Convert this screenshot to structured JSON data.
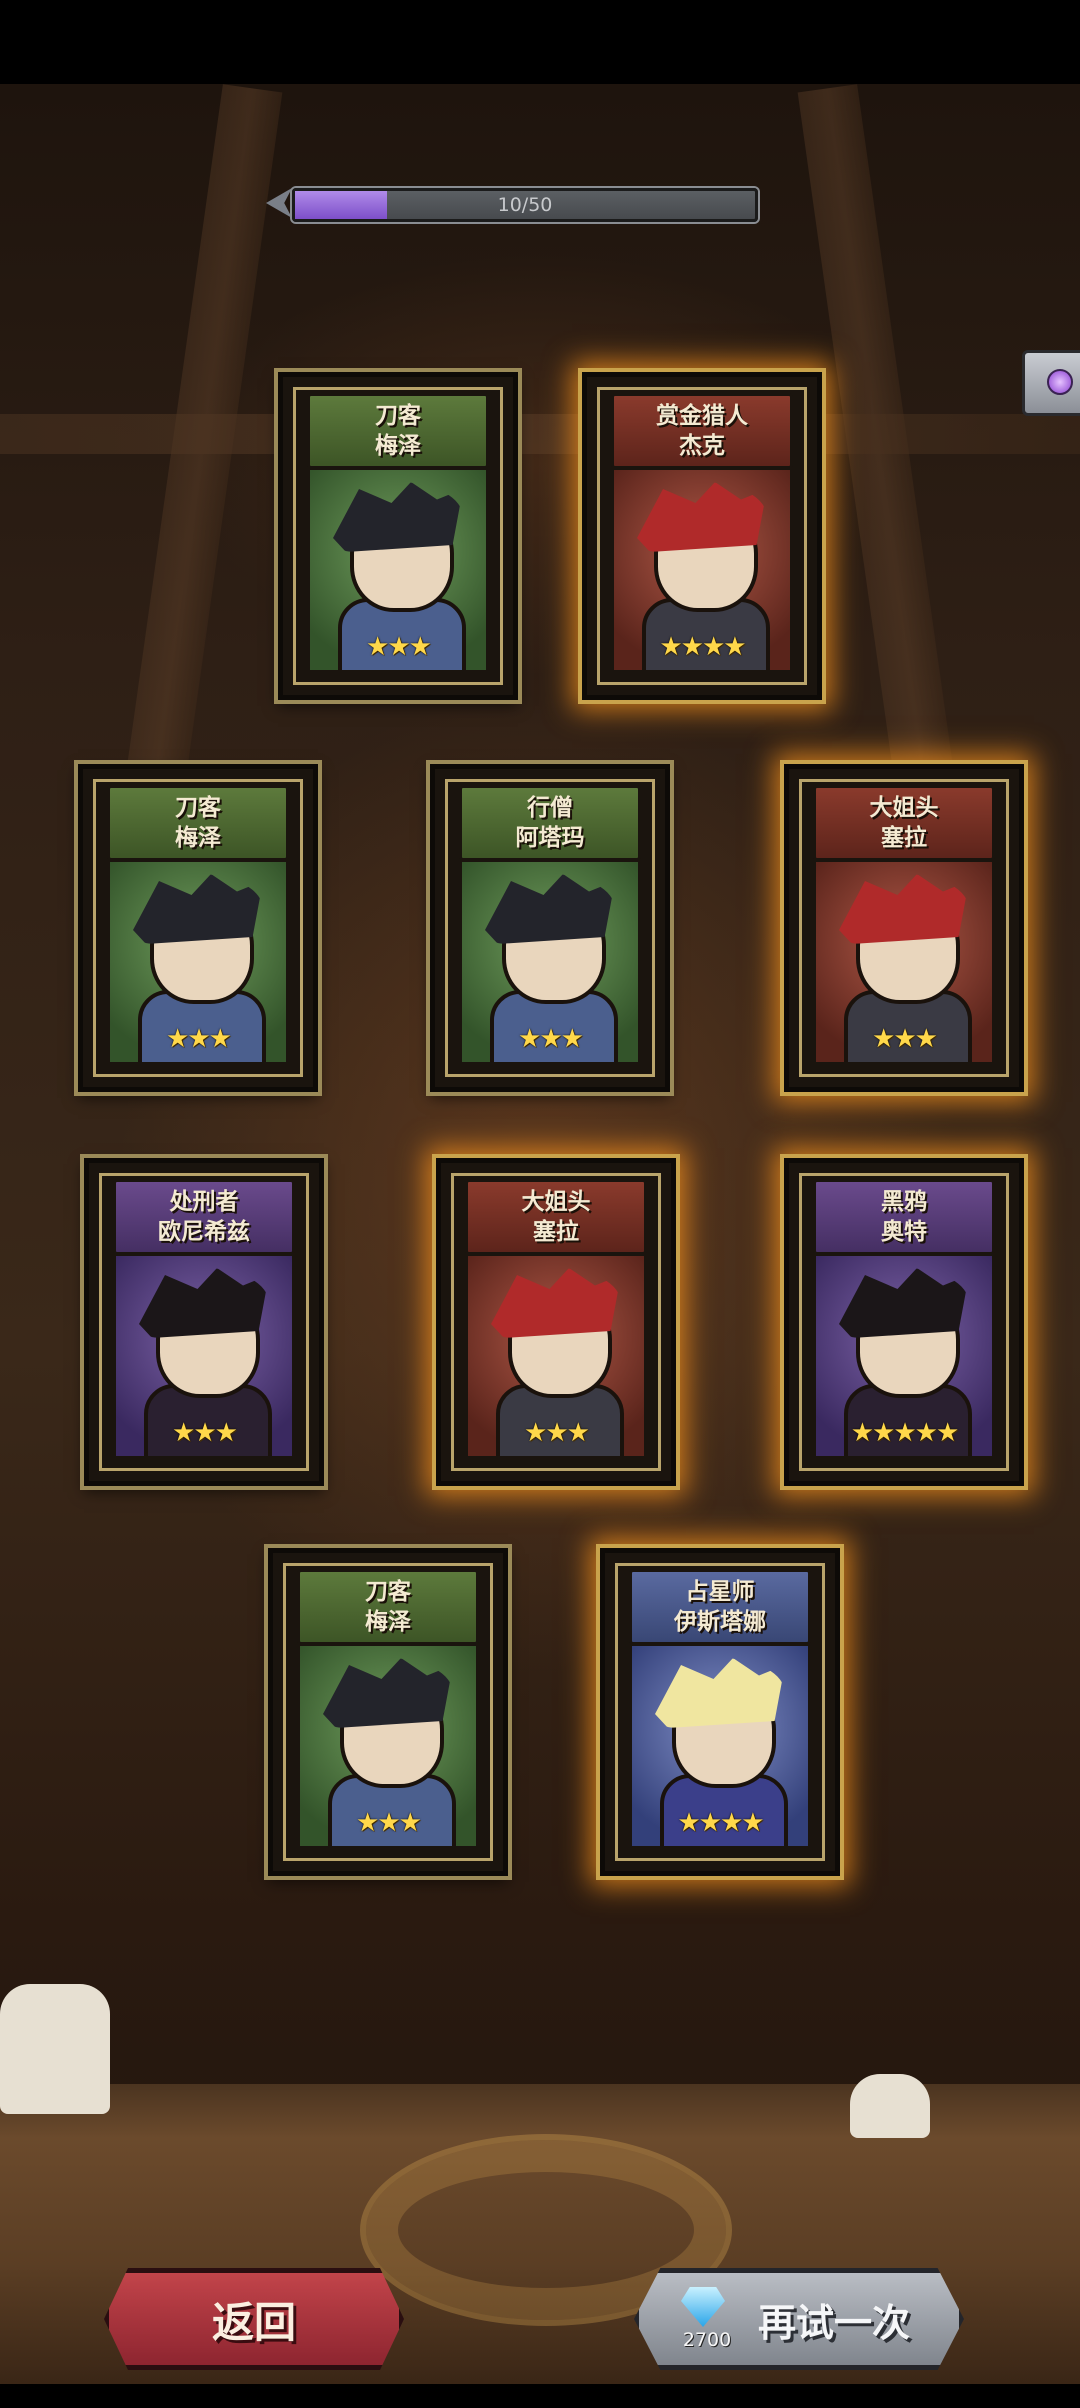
{
  "progress": {
    "text": "10/50",
    "fraction": 0.2
  },
  "cards": [
    {
      "role": "刀客",
      "name": "梅泽",
      "stars": "★★★",
      "rarity": "green"
    },
    {
      "role": "赏金猎人",
      "name": "杰克",
      "stars": "★★★★",
      "rarity": "red"
    },
    {
      "role": "刀客",
      "name": "梅泽",
      "stars": "★★★",
      "rarity": "green"
    },
    {
      "role": "行僧",
      "name": "阿塔玛",
      "stars": "★★★",
      "rarity": "green"
    },
    {
      "role": "大姐头",
      "name": "塞拉",
      "stars": "★★★",
      "rarity": "red"
    },
    {
      "role": "处刑者",
      "name": "欧尼希兹",
      "stars": "★★★",
      "rarity": "purple"
    },
    {
      "role": "大姐头",
      "name": "塞拉",
      "stars": "★★★",
      "rarity": "red"
    },
    {
      "role": "黑鸦",
      "name": "奥特",
      "stars": "★★★★★",
      "rarity": "purple"
    },
    {
      "role": "刀客",
      "name": "梅泽",
      "stars": "★★★",
      "rarity": "green"
    },
    {
      "role": "占星师",
      "name": "伊斯塔娜",
      "stars": "★★★★",
      "rarity": "blue"
    }
  ],
  "buttons": {
    "back": "返回",
    "retry": "再试一次",
    "retry_cost": "2700"
  },
  "colors": {
    "glow": "#ff961e",
    "star": "#ffd84a",
    "progress_fill": "#9a6cdb"
  },
  "icons": {
    "chest": "treasure-chest-icon",
    "currency": "diamond-icon",
    "arrow": "double-chevron-left-icon"
  }
}
